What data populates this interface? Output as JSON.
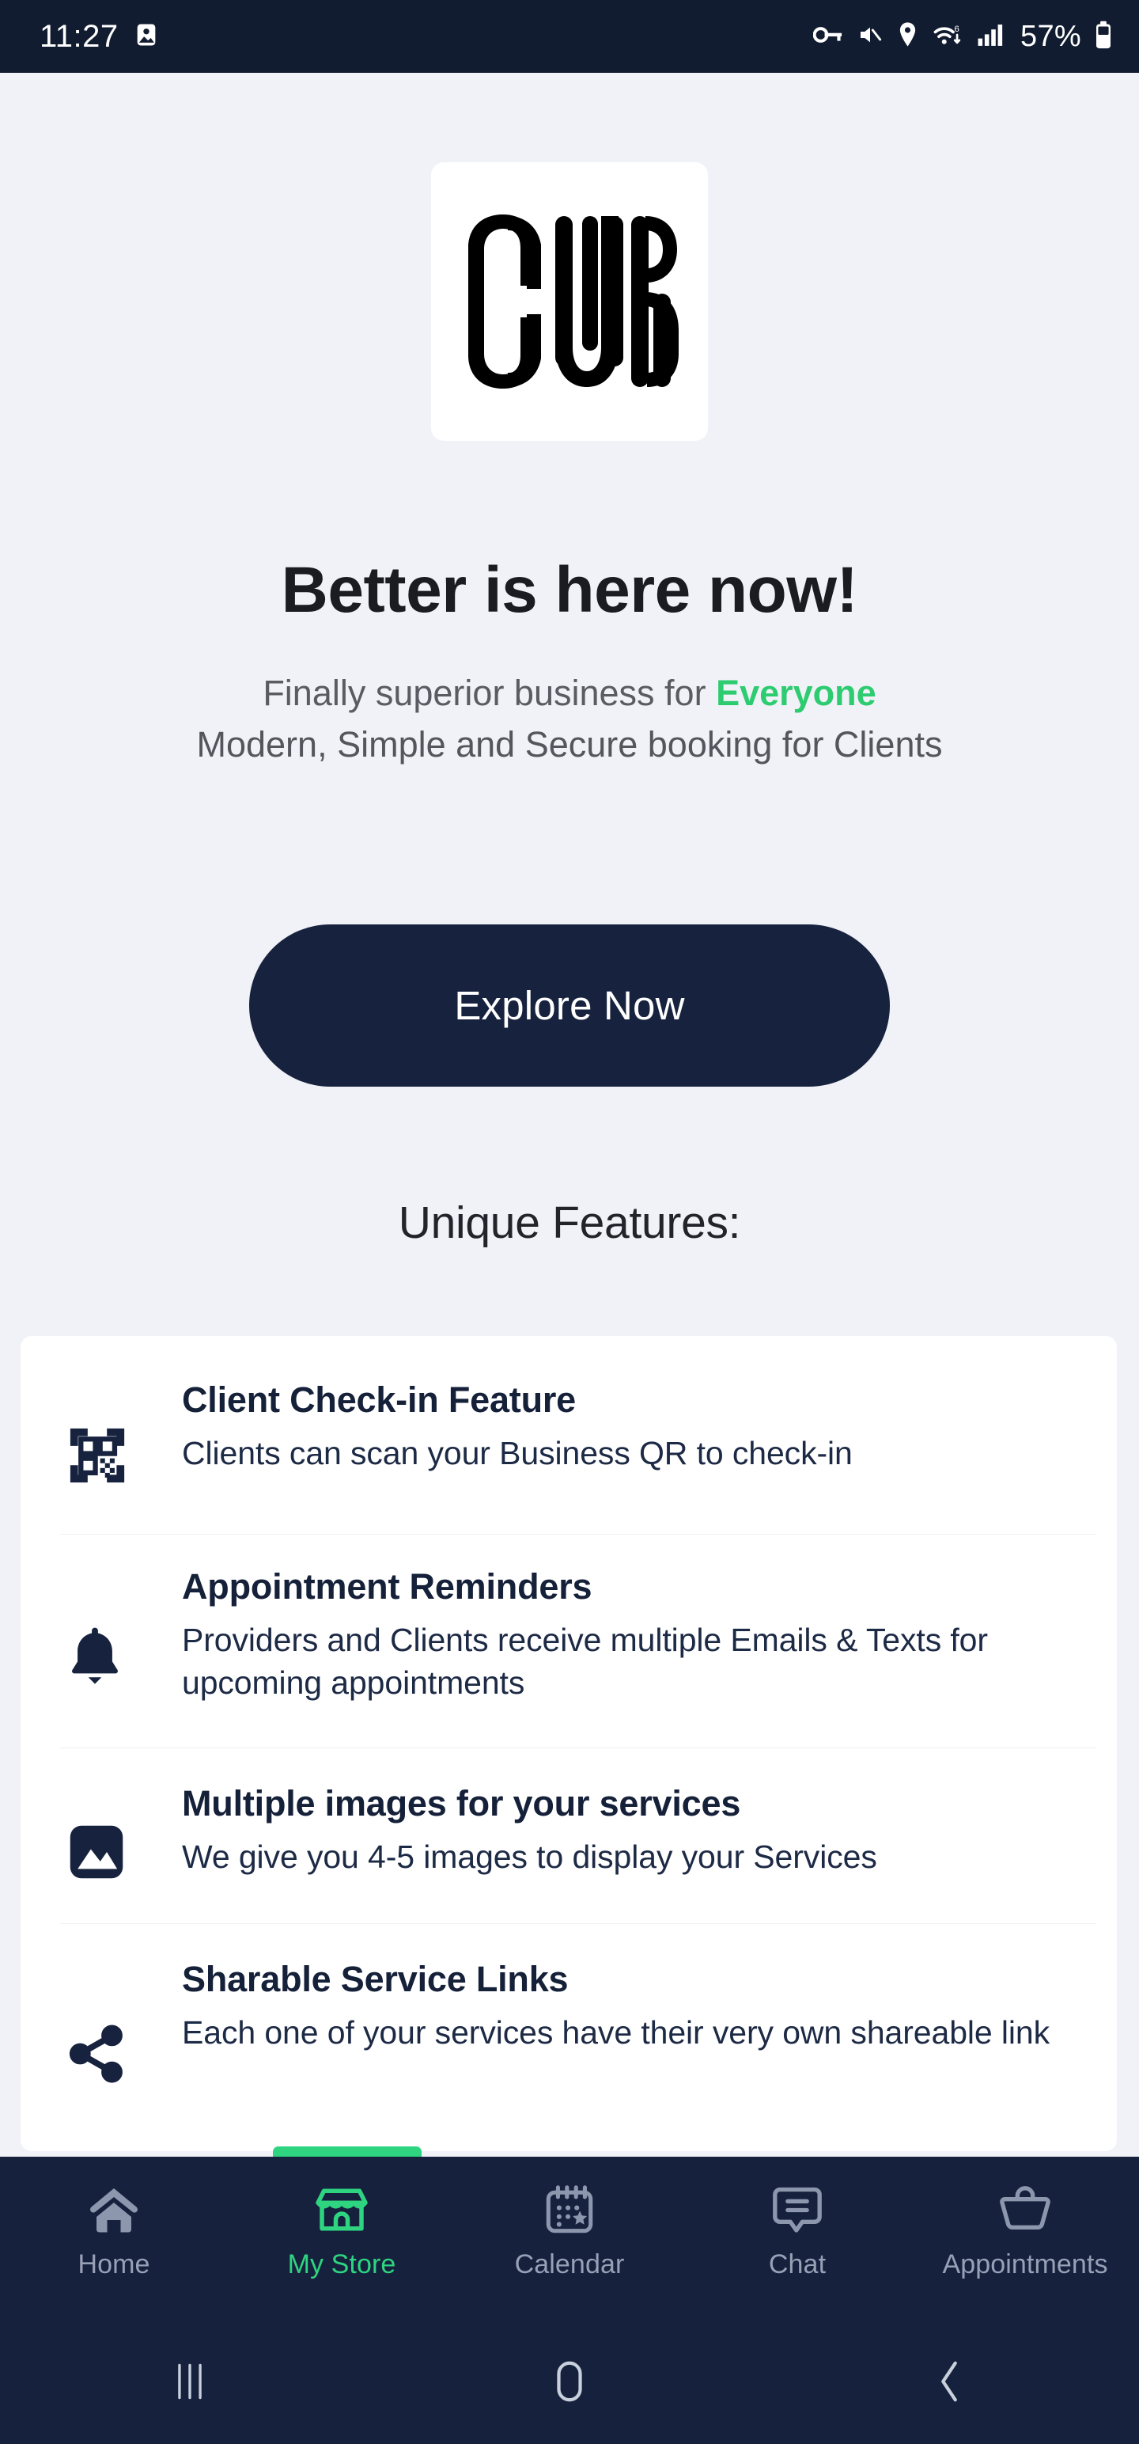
{
  "statusbar": {
    "time": "11:27",
    "battery_percent": "57%",
    "icons": {
      "gallery": "image-icon",
      "vpn_key": "key-icon",
      "mute": "mute-icon",
      "location": "location-pin-icon",
      "wifi": "wifi-icon",
      "signal": "cellular-signal-icon",
      "battery": "battery-icon"
    }
  },
  "logo": {
    "name": "cub-logo",
    "text": "CUB",
    "bg": "#FFFFFF",
    "mark_color": "#000000"
  },
  "hero": {
    "headline": "Better is here now!",
    "subtitle_line1_prefix": "Finally superior business for ",
    "subtitle_line1_accent": "Everyone",
    "subtitle_line2": "Modern, Simple and Secure booking for Clients",
    "accent_color": "#2ECC71"
  },
  "cta": {
    "label": "Explore Now",
    "bg": "#17233E",
    "text_color": "#FFFFFF"
  },
  "features_section": {
    "title": "Unique Features:",
    "items": [
      {
        "icon": "qr-code-scan-icon",
        "title": "Client Check-in Feature",
        "description": "Clients can scan your Business QR to check-in"
      },
      {
        "icon": "bell-icon",
        "title": "Appointment Reminders",
        "description": "Providers and Clients receive multiple Emails & Texts for upcoming appointments"
      },
      {
        "icon": "image-icon",
        "title": "Multiple images for your services",
        "description": "We give you 4-5 images to display your Services"
      },
      {
        "icon": "share-icon",
        "title": "Sharable Service Links",
        "description": "Each one of your services have their very own shareable link"
      }
    ]
  },
  "bottom_nav": {
    "active_index": 1,
    "active_color": "#2ED47F",
    "inactive_color": "#97A0B5",
    "bg": "#16213E",
    "items": [
      {
        "label": "Home",
        "icon": "home-icon"
      },
      {
        "label": "My Store",
        "icon": "store-icon"
      },
      {
        "label": "Calendar",
        "icon": "calendar-star-icon"
      },
      {
        "label": "Chat",
        "icon": "chat-bubble-icon"
      },
      {
        "label": "Appointments",
        "icon": "basket-icon"
      }
    ]
  },
  "android_nav": {
    "recents": "recents-icon",
    "home": "home-pill-icon",
    "back": "back-chevron-icon"
  }
}
